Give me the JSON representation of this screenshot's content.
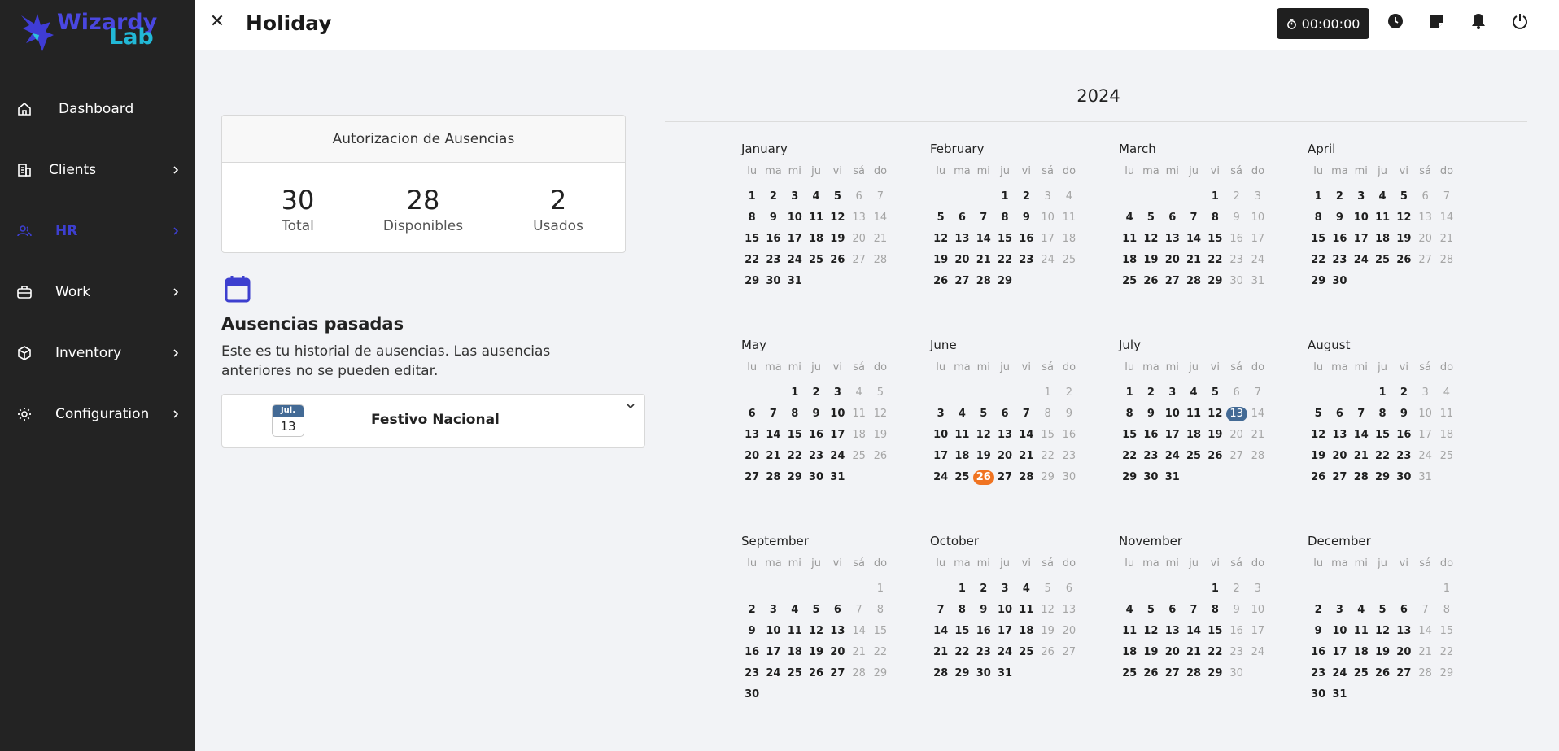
{
  "brand": {
    "line1": "Wizardy",
    "line2": "Lab"
  },
  "sidebar": {
    "items": [
      {
        "label": "Dashboard",
        "icon": "home-icon",
        "has_chevron": false
      },
      {
        "label": "Clients",
        "icon": "building-icon",
        "has_chevron": true
      },
      {
        "label": "HR",
        "icon": "users-icon",
        "has_chevron": true,
        "active": true
      },
      {
        "label": "Work",
        "icon": "briefcase-icon",
        "has_chevron": true
      },
      {
        "label": "Inventory",
        "icon": "box-icon",
        "has_chevron": true
      },
      {
        "label": "Configuration",
        "icon": "gear-icon",
        "has_chevron": true
      }
    ]
  },
  "header": {
    "title": "Holiday",
    "timer": "00:00:00",
    "icons": [
      "clock-icon",
      "note-icon",
      "bell-icon",
      "power-icon"
    ]
  },
  "summary": {
    "title": "Autorizacion de Ausencias",
    "total": {
      "value": "30",
      "label": "Total"
    },
    "available": {
      "value": "28",
      "label": "Disponibles"
    },
    "used": {
      "value": "2",
      "label": "Usados"
    }
  },
  "past": {
    "title": "Ausencias pasadas",
    "description": "Este es tu historial de ausencias. Las ausencias anteriores no se pueden editar.",
    "items": [
      {
        "month": "Jul.",
        "day": "13",
        "name": "Festivo Nacional"
      }
    ]
  },
  "calendar": {
    "year": "2024",
    "weekdays": [
      "lu",
      "ma",
      "mi",
      "ju",
      "vi",
      "sá",
      "do"
    ],
    "colors": {
      "blue": "#436a95",
      "orange": "#f07321",
      "accent": "#3d3fcf"
    },
    "months": [
      {
        "name": "January",
        "offset": 0,
        "days": 31
      },
      {
        "name": "February",
        "offset": 3,
        "days": 29
      },
      {
        "name": "March",
        "offset": 4,
        "days": 31
      },
      {
        "name": "April",
        "offset": 0,
        "days": 30
      },
      {
        "name": "May",
        "offset": 2,
        "days": 31
      },
      {
        "name": "June",
        "offset": 5,
        "days": 30,
        "highlight_orange": [
          26
        ]
      },
      {
        "name": "July",
        "offset": 0,
        "days": 31,
        "highlight_blue": [
          13
        ]
      },
      {
        "name": "August",
        "offset": 3,
        "days": 31
      },
      {
        "name": "September",
        "offset": 6,
        "days": 30
      },
      {
        "name": "October",
        "offset": 1,
        "days": 31
      },
      {
        "name": "November",
        "offset": 4,
        "days": 30
      },
      {
        "name": "December",
        "offset": 6,
        "days": 31
      }
    ]
  }
}
